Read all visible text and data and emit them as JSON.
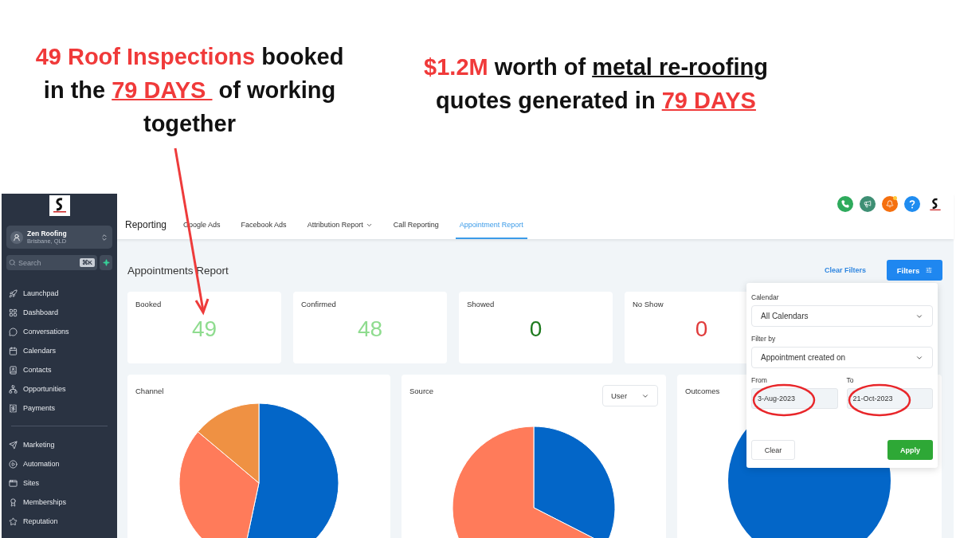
{
  "headlines": [
    {
      "segments": [
        {
          "text": "49 Roof Inspections",
          "kind": "emphasis"
        },
        {
          "text": " booked in the ",
          "kind": "plain"
        },
        {
          "text": "79 DAYS ",
          "kind": "emphasis_underlined"
        },
        {
          "text": " of working together",
          "kind": "plain"
        }
      ]
    },
    {
      "segments": [
        {
          "text": "$1.2M",
          "kind": "emphasis"
        },
        {
          "text": " worth of ",
          "kind": "plain"
        },
        {
          "text": "metal re-roofing",
          "kind": "underlined"
        },
        {
          "text": " quotes generated in ",
          "kind": "plain"
        },
        {
          "text": "79 DAYS",
          "kind": "emphasis_underlined"
        }
      ]
    }
  ],
  "sidebar": {
    "account": {
      "name": "Zen Roofing",
      "location": "Brisbane, QLD"
    },
    "search": {
      "placeholder": "Search",
      "shortcut": "⌘K"
    },
    "groups": [
      [
        {
          "label": "Launchpad"
        },
        {
          "label": "Dashboard"
        },
        {
          "label": "Conversations"
        },
        {
          "label": "Calendars"
        },
        {
          "label": "Contacts"
        },
        {
          "label": "Opportunities"
        },
        {
          "label": "Payments"
        }
      ],
      [
        {
          "label": "Marketing"
        },
        {
          "label": "Automation"
        },
        {
          "label": "Sites"
        },
        {
          "label": "Memberships"
        },
        {
          "label": "Reputation"
        }
      ]
    ]
  },
  "header": {
    "title": "Reporting",
    "tabs": [
      {
        "label": "Google Ads",
        "selected": false,
        "has_menu": false
      },
      {
        "label": "Facebook Ads",
        "selected": false,
        "has_menu": false
      },
      {
        "label": "Attribution Report",
        "selected": false,
        "has_menu": true
      },
      {
        "label": "Call Reporting",
        "selected": false,
        "has_menu": false
      },
      {
        "label": "Appointment Report",
        "selected": true,
        "has_menu": false
      }
    ],
    "buttons": [
      {
        "kind": "phone",
        "color": "#2eaa5c",
        "badge": false
      },
      {
        "kind": "megaphone",
        "color": "#3e8f74",
        "badge": false
      },
      {
        "kind": "bell",
        "color": "#f5700f",
        "badge": true
      },
      {
        "kind": "help",
        "color": "#1f8cf0",
        "badge": false
      }
    ]
  },
  "page": {
    "title": "Appointments Report",
    "clear_filters": "Clear Filters",
    "filters_button": "Filters"
  },
  "stats": [
    {
      "label": "Booked",
      "value": "49",
      "color": "#8fdc8f"
    },
    {
      "label": "Confirmed",
      "value": "48",
      "color": "#8fdc8f"
    },
    {
      "label": "Showed",
      "value": "0",
      "color": "#1e7a1e"
    },
    {
      "label": "No Show",
      "value": "0",
      "color": "#e03b3b"
    }
  ],
  "charts": [
    {
      "title": "Channel"
    },
    {
      "title": "Source",
      "dropdown": "User"
    },
    {
      "title": "Outcomes"
    }
  ],
  "filter_panel": {
    "calendar_label": "Calendar",
    "calendar_value": "All Calendars",
    "filter_by_label": "Filter by",
    "filter_by_value": "Appointment created on",
    "from_label": "From",
    "from_value": "3-Aug-2023",
    "from_circled": true,
    "to_label": "To",
    "to_value": "21-Oct-2023",
    "to_circled": true,
    "clear": "Clear",
    "apply": "Apply"
  }
}
